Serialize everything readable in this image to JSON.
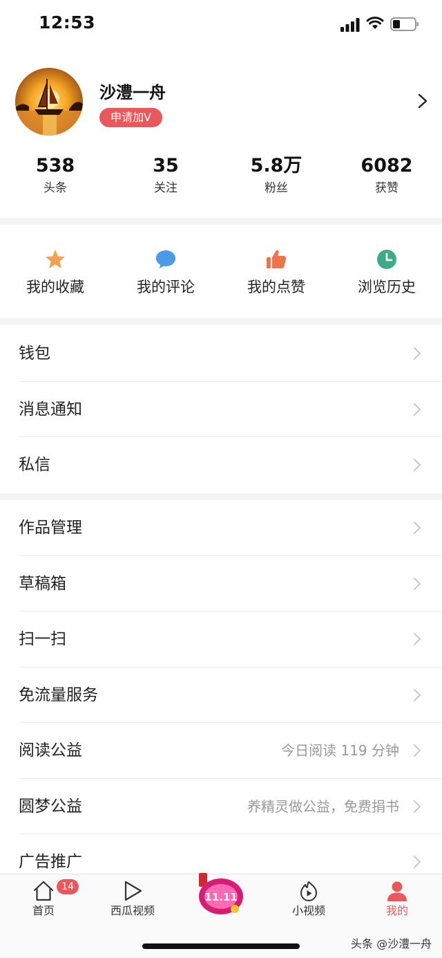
{
  "status_bar": {
    "time": "12:53"
  },
  "profile": {
    "username": "沙澧一舟",
    "apply_badge": "申请加V",
    "stats": [
      {
        "value": "538",
        "label": "头条"
      },
      {
        "value": "35",
        "label": "关注"
      },
      {
        "value": "5.8万",
        "label": "粉丝"
      },
      {
        "value": "6082",
        "label": "获赞"
      }
    ]
  },
  "quick_actions": [
    {
      "label": "我的收藏",
      "icon": "star-icon",
      "color": "#f5a04a"
    },
    {
      "label": "我的评论",
      "icon": "comment-icon",
      "color": "#4a9ae8"
    },
    {
      "label": "我的点赞",
      "icon": "thumbs-up-icon",
      "color": "#f0744a"
    },
    {
      "label": "浏览历史",
      "icon": "clock-icon",
      "color": "#3dab87"
    }
  ],
  "menu_group_1": [
    {
      "label": "钱包",
      "hint": ""
    },
    {
      "label": "消息通知",
      "hint": ""
    },
    {
      "label": "私信",
      "hint": ""
    }
  ],
  "menu_group_2": [
    {
      "label": "作品管理",
      "hint": ""
    },
    {
      "label": "草稿箱",
      "hint": ""
    },
    {
      "label": "扫一扫",
      "hint": ""
    },
    {
      "label": "免流量服务",
      "hint": ""
    },
    {
      "label": "阅读公益",
      "hint": "今日阅读 119 分钟"
    },
    {
      "label": "圆梦公益",
      "hint": "养精灵做公益，免费捐书"
    },
    {
      "label": "广告推广",
      "hint": ""
    }
  ],
  "tab_bar": {
    "home": {
      "label": "首页",
      "badge": "14"
    },
    "xigua": {
      "label": "西瓜视频"
    },
    "promo": {
      "text": "11.11"
    },
    "small_video": {
      "label": "小视频"
    },
    "mine": {
      "label": "我的"
    }
  },
  "watermark": "头条 @沙澧一舟",
  "colors": {
    "accent": "#e9595b",
    "separator": "#f4f4f4",
    "hint": "#999999"
  }
}
